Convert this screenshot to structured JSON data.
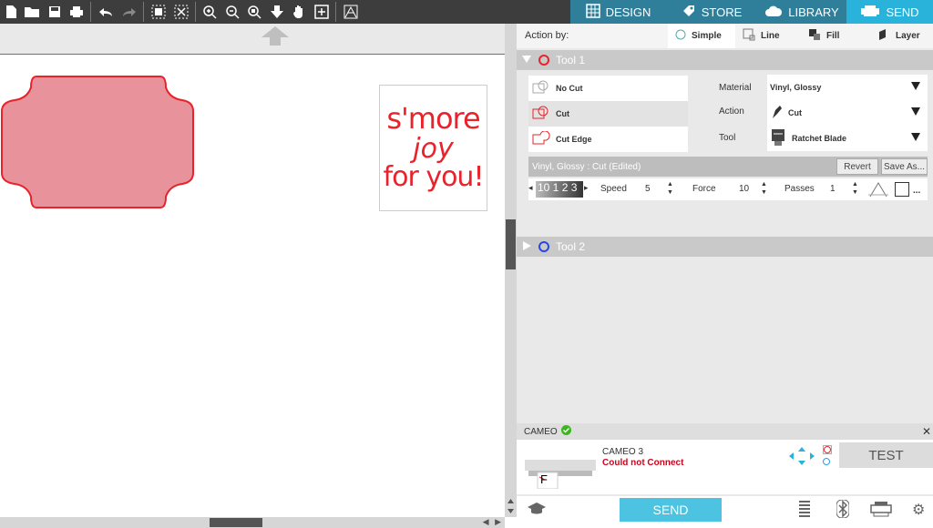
{
  "nav": {
    "design": "DESIGN",
    "store": "STORE",
    "library": "LIBRARY",
    "send": "SEND"
  },
  "canvas": {
    "design_text": [
      "s'more",
      "joy",
      "for you!"
    ]
  },
  "panel": {
    "action_by_label": "Action by:",
    "tabs": [
      "Simple",
      "Line",
      "Fill",
      "Layer"
    ],
    "tool1": {
      "title": "Tool 1",
      "color": "#e8232b"
    },
    "tool2": {
      "title": "Tool 2",
      "color": "#2b46e8"
    },
    "actions": [
      "No Cut",
      "Cut",
      "Cut Edge"
    ],
    "material_label": "Material",
    "material_value": "Vinyl, Glossy",
    "action_label": "Action",
    "action_value": "Cut",
    "tool_label": "Tool",
    "tool_value": "Ratchet Blade",
    "preset": "Vinyl, Glossy : Cut (Edited)",
    "revert": "Revert",
    "save_as": "Save As...",
    "blade_depth": "10 1 2 3",
    "speed_label": "Speed",
    "speed_value": "5",
    "force_label": "Force",
    "force_value": "10",
    "passes_label": "Passes",
    "passes_value": "1"
  },
  "machine": {
    "header": "CAMEO",
    "name": "CAMEO 3",
    "status": "Could not Connect",
    "status_color": "#d0021b",
    "connected_color": "#3cb521",
    "thumb_letter": "F",
    "test": "TEST",
    "send": "SEND"
  },
  "colors": {
    "accent": "#2ab3da",
    "shape_fill": "#e8939b",
    "shape_stroke": "#e8232b"
  }
}
